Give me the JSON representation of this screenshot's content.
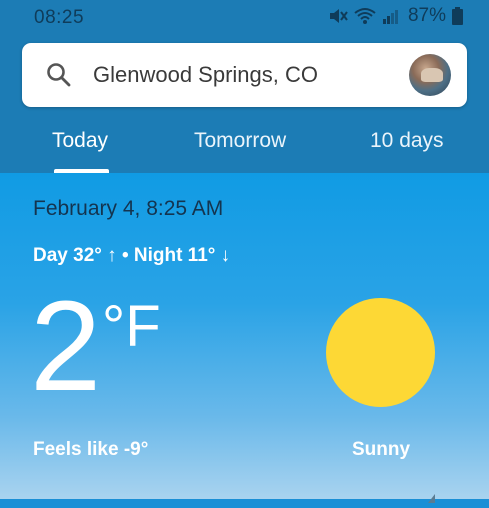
{
  "status_bar": {
    "time": "08:25",
    "battery_percent": "87%",
    "icons": [
      "mute-icon",
      "wifi-icon",
      "signal-icon",
      "battery-icon"
    ]
  },
  "search": {
    "location": "Glenwood Springs, CO",
    "icon": "search-icon"
  },
  "tabs": [
    {
      "label": "Today",
      "selected": true
    },
    {
      "label": "Tomorrow",
      "selected": false
    },
    {
      "label": "10 days",
      "selected": false
    }
  ],
  "weather": {
    "date_time": "February 4, 8:25 AM",
    "day_high": "Day 32° ↑",
    "night_low": "• Night 11° ↓",
    "temperature": "2",
    "unit": "°F",
    "feels_like": "Feels like -9°",
    "condition": "Sunny",
    "condition_icon": "sun-icon"
  },
  "colors": {
    "header": "#1c7cb5",
    "sky_top": "#109be4",
    "sun": "#fdd835"
  }
}
